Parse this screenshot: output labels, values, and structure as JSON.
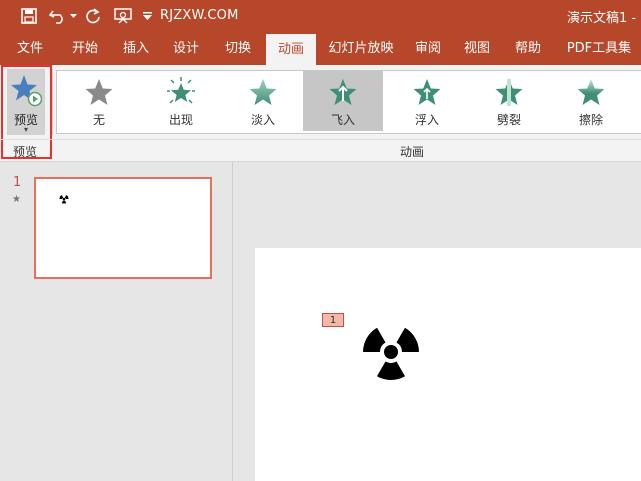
{
  "titlebar": {
    "site": "RJZXW.COM",
    "doc_title": "演示文稿1 -",
    "icons": [
      "save-icon",
      "undo-icon",
      "undo-dropdown-icon",
      "redo-icon",
      "present-from-start-icon",
      "customize-qat-icon"
    ]
  },
  "tabs": [
    {
      "label": "文件"
    },
    {
      "label": "开始"
    },
    {
      "label": "插入"
    },
    {
      "label": "设计"
    },
    {
      "label": "切换"
    },
    {
      "label": "动画",
      "active": true
    },
    {
      "label": "幻灯片放映"
    },
    {
      "label": "审阅"
    },
    {
      "label": "视图"
    },
    {
      "label": "帮助"
    },
    {
      "label": "PDF工具集"
    }
  ],
  "ribbon": {
    "preview": {
      "button_label": "预览",
      "group_label": "预览"
    },
    "animation": {
      "group_label": "动画",
      "effects": [
        {
          "label": "无"
        },
        {
          "label": "出现"
        },
        {
          "label": "淡入"
        },
        {
          "label": "飞入",
          "selected": true
        },
        {
          "label": "浮入"
        },
        {
          "label": "劈裂"
        },
        {
          "label": "擦除"
        }
      ]
    }
  },
  "slides_panel": {
    "slide_number": "1",
    "animation_marker": "★"
  },
  "canvas": {
    "animation_badge": "1"
  },
  "colors": {
    "accent": "#b7472a",
    "ribbon_bg": "#f3f3f3",
    "highlight_border": "#e5322f",
    "selection": "#c6c6c6"
  }
}
